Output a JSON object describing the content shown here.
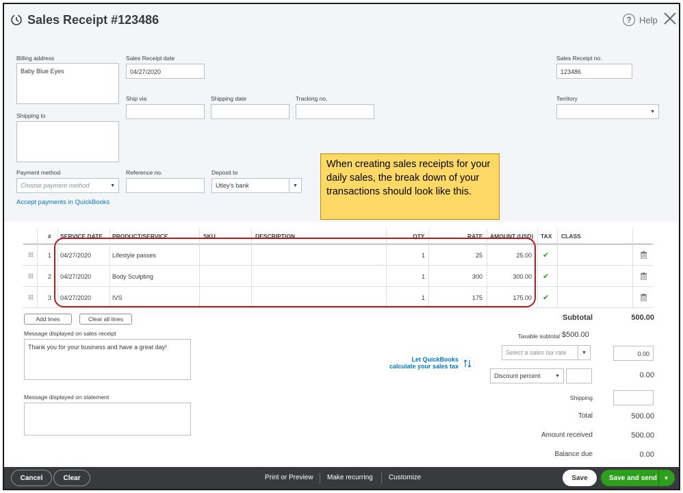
{
  "header": {
    "title": "Sales Receipt #123486",
    "help_label": "Help"
  },
  "form": {
    "billing_address_label": "Billing address",
    "billing_address_value": "Baby Blue Eyes",
    "sales_receipt_date_label": "Sales Receipt date",
    "sales_receipt_date_value": "04/27/2020",
    "sales_receipt_no_label": "Sales Receipt no.",
    "sales_receipt_no_value": "123486",
    "ship_via_label": "Ship via",
    "shipping_date_label": "Shipping date",
    "tracking_no_label": "Tracking no.",
    "territory_label": "Territory",
    "shipping_to_label": "Shipping to",
    "payment_method_label": "Payment method",
    "payment_method_placeholder": "Choose payment method",
    "reference_no_label": "Reference no.",
    "deposit_to_label": "Deposit to",
    "deposit_to_value": "Utley's bank",
    "accept_payments_link": "Accept payments in QuickBooks"
  },
  "callout": {
    "text": "When creating sales receipts for your daily sales, the break down of your transactions should look like this."
  },
  "table": {
    "headers": [
      "#",
      "SERVICE DATE",
      "PRODUCT/SERVICE",
      "SKU",
      "DESCRIPTION",
      "QTY",
      "RATE",
      "AMOUNT (USD)",
      "TAX",
      "CLASS"
    ],
    "rows": [
      {
        "num": "1",
        "date": "04/27/2020",
        "product": "Lifestyle passes",
        "qty": "1",
        "rate": "25",
        "amount": "25.00"
      },
      {
        "num": "2",
        "date": "04/27/2020",
        "product": "Body Sculpting",
        "qty": "1",
        "rate": "300",
        "amount": "300.00"
      },
      {
        "num": "3",
        "date": "04/27/2020",
        "product": "IVS",
        "qty": "1",
        "rate": "175",
        "amount": "175.00"
      }
    ]
  },
  "actions": {
    "add_lines": "Add lines",
    "clear_all_lines": "Clear all lines"
  },
  "messages": {
    "receipt_label": "Message displayed on sales receipt",
    "receipt_value": "Thank you for your business and have a great day!",
    "statement_label": "Message displayed on statement"
  },
  "tax": {
    "let_qb_line1": "Let QuickBooks",
    "let_qb_line2": "calculate your sales tax",
    "rate_placeholder": "Select a sales tax rate",
    "rate_value": "0.00",
    "discount_label": "Discount percent"
  },
  "summary": {
    "subtotal_label": "Subtotal",
    "subtotal_value": "500.00",
    "taxable_subtotal_label": "Taxable subtotal",
    "taxable_subtotal_value": "$500.00",
    "discount_value": "0.00",
    "shipping_label": "Shipping",
    "total_label": "Total",
    "total_value": "500.00",
    "amount_received_label": "Amount received",
    "amount_received_value": "500.00",
    "balance_due_label": "Balance due",
    "balance_due_value": "0.00"
  },
  "footer": {
    "cancel": "Cancel",
    "clear": "Clear",
    "print_or_preview": "Print or Preview",
    "make_recurring": "Make recurring",
    "customize": "Customize",
    "save": "Save",
    "save_and_send": "Save and send"
  },
  "colors": {
    "accent_green": "#2ca01c",
    "link_blue": "#0077c5",
    "callout_yellow": "#ffd966",
    "highlight_red": "#b01c1c",
    "footer_dark": "#393a3d"
  }
}
